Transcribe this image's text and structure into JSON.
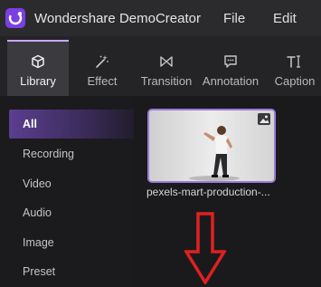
{
  "app": {
    "title": "Wondershare DemoCreator",
    "logo_icon": "democreator-logo-icon",
    "accent_color": "#c9a8ff",
    "menu": {
      "file": "File",
      "edit": "Edit"
    }
  },
  "tabs": [
    {
      "label": "Library",
      "icon": "cube-icon",
      "active": true
    },
    {
      "label": "Effect",
      "icon": "magic-wand-icon",
      "active": false
    },
    {
      "label": "Transition",
      "icon": "transition-icon",
      "active": false
    },
    {
      "label": "Annotation",
      "icon": "annotation-icon",
      "active": false
    },
    {
      "label": "Caption",
      "icon": "caption-icon",
      "active": false
    }
  ],
  "sidebar": {
    "items": [
      {
        "label": "All",
        "active": true
      },
      {
        "label": "Recording",
        "active": false
      },
      {
        "label": "Video",
        "active": false
      },
      {
        "label": "Audio",
        "active": false
      },
      {
        "label": "Image",
        "active": false
      },
      {
        "label": "Preset",
        "active": false
      }
    ]
  },
  "library": {
    "clips": [
      {
        "name": "pexels-mart-production-...",
        "badge_icon": "image-icon"
      }
    ],
    "annotation_arrow": {
      "color": "#e02020",
      "icon": "down-arrow-icon"
    }
  }
}
